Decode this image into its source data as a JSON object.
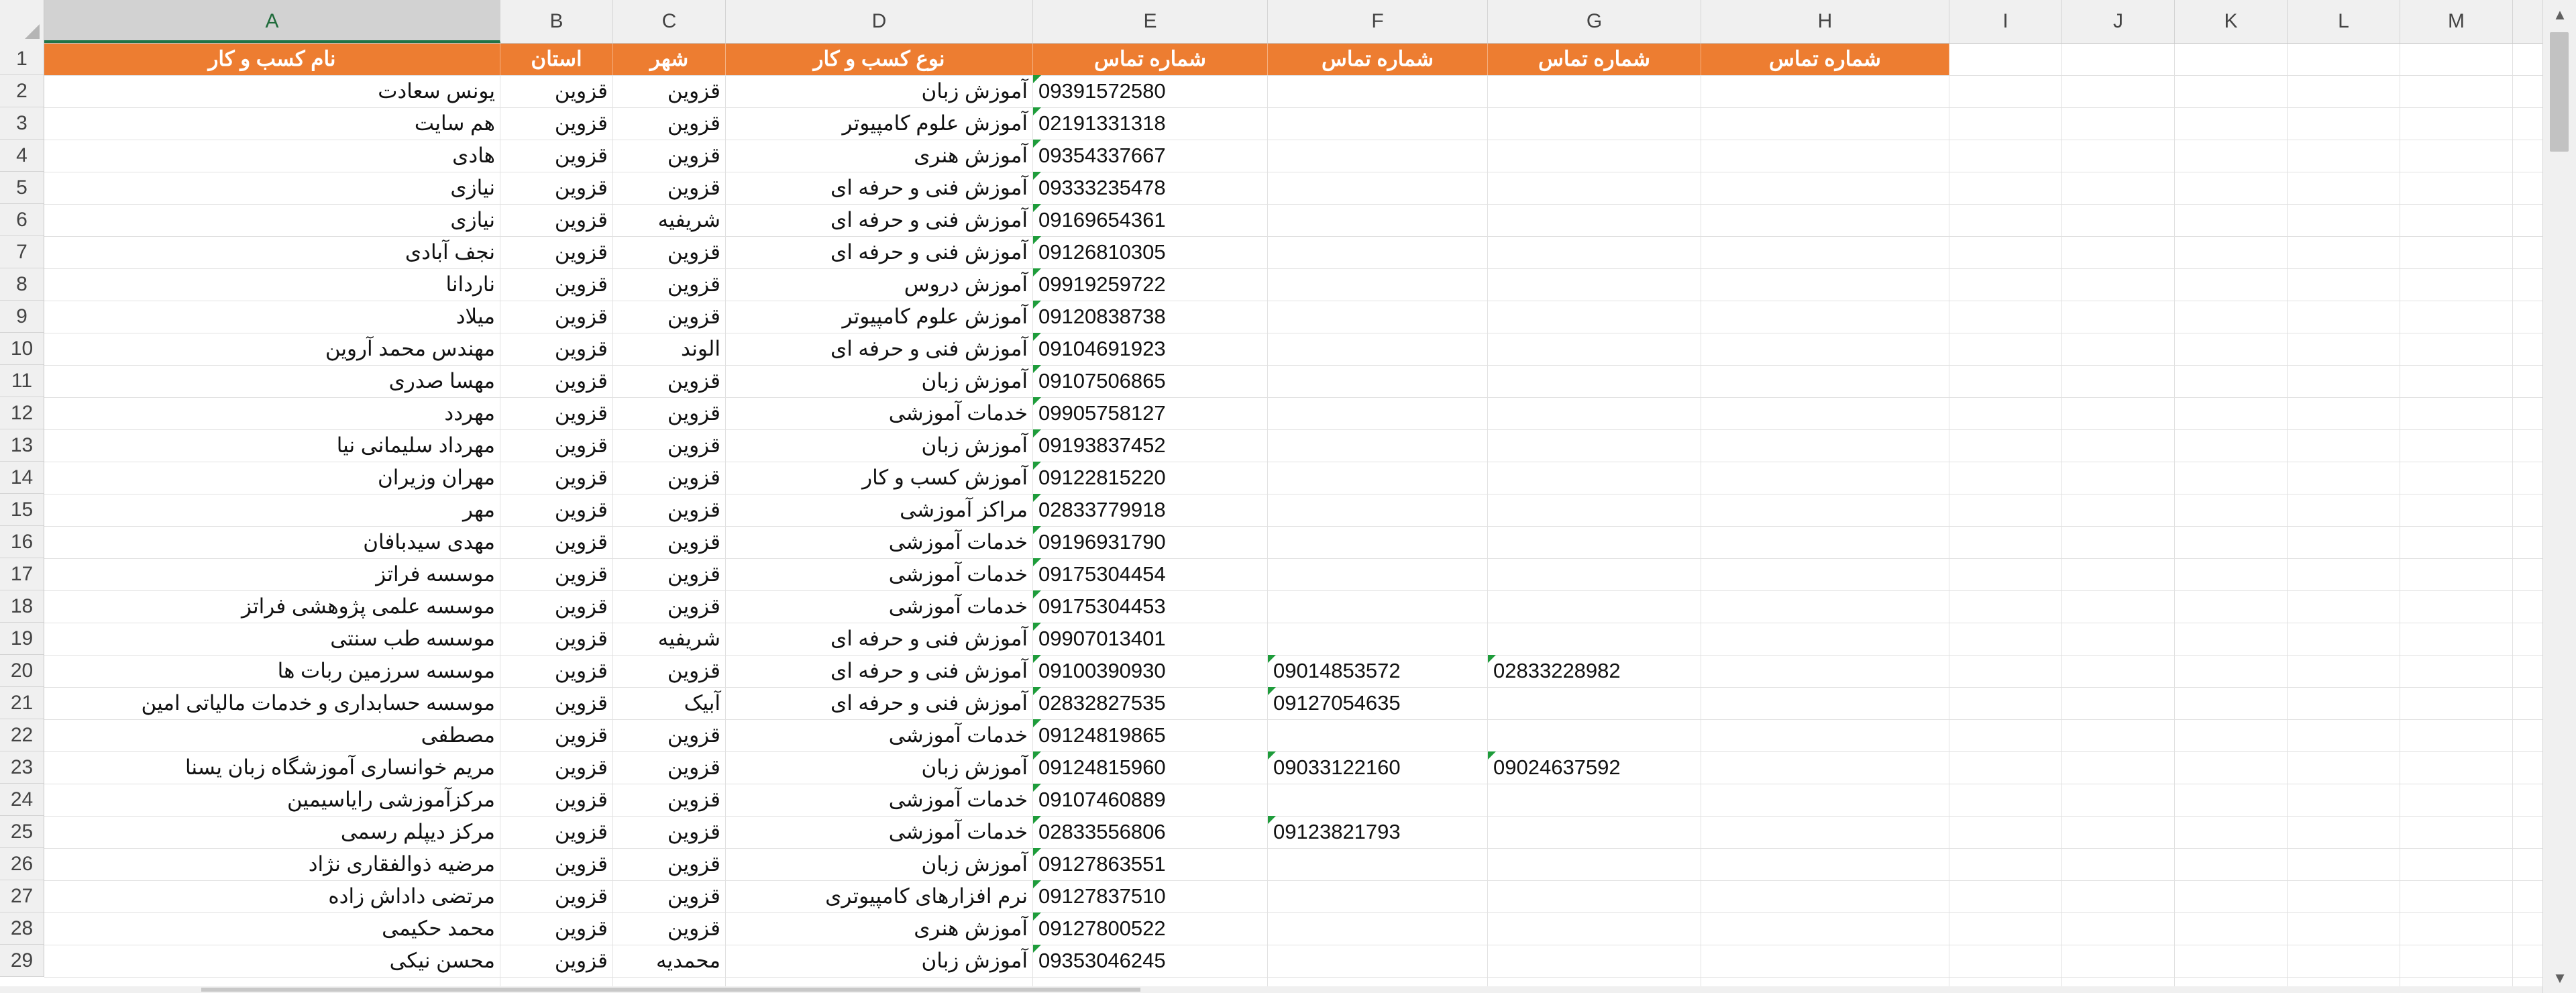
{
  "columns": [
    {
      "letter": "A",
      "active": true
    },
    {
      "letter": "B"
    },
    {
      "letter": "C"
    },
    {
      "letter": "D"
    },
    {
      "letter": "E"
    },
    {
      "letter": "F"
    },
    {
      "letter": "G"
    },
    {
      "letter": "H"
    },
    {
      "letter": "I"
    },
    {
      "letter": "J"
    },
    {
      "letter": "K"
    },
    {
      "letter": "L"
    },
    {
      "letter": "M"
    }
  ],
  "header_row": {
    "A": "نام کسب و کار",
    "B": "استان",
    "C": "شهر",
    "D": "نوع کسب و کار",
    "E": "شماره تماس",
    "F": "شماره تماس",
    "G": "شماره تماس",
    "H": "شماره تماس"
  },
  "header_fill_color": "#ed7d31",
  "header_text_color": "#ffffff",
  "error_flag_color": "#1e9c3b",
  "rows": [
    {
      "n": "1"
    },
    {
      "n": "2",
      "A": "یونس سعادت",
      "B": "قزوین",
      "C": "قزوین",
      "D": "آموزش زبان",
      "E": "09391572580"
    },
    {
      "n": "3",
      "A": "هم سایت",
      "B": "قزوین",
      "C": "قزوین",
      "D": "آموزش علوم کامپیوتر",
      "E": "02191331318"
    },
    {
      "n": "4",
      "A": "هادی",
      "B": "قزوین",
      "C": "قزوین",
      "D": "آموزش هنری",
      "E": "09354337667"
    },
    {
      "n": "5",
      "A": "نیازی",
      "B": "قزوین",
      "C": "قزوین",
      "D": "آموزش فنی و حرفه ای",
      "E": "09333235478"
    },
    {
      "n": "6",
      "A": "نیازی",
      "B": "قزوین",
      "C": "شریفیه",
      "D": "آموزش فنی و حرفه ای",
      "E": "09169654361"
    },
    {
      "n": "7",
      "A": "نجف آبادی",
      "B": "قزوین",
      "C": "قزوین",
      "D": "آموزش فنی و حرفه ای",
      "E": "09126810305"
    },
    {
      "n": "8",
      "A": "ناردانا",
      "B": "قزوین",
      "C": "قزوین",
      "D": "آموزش دروس",
      "E": "09919259722"
    },
    {
      "n": "9",
      "A": "میلاد",
      "B": "قزوین",
      "C": "قزوین",
      "D": "آموزش علوم کامپیوتر",
      "E": "09120838738"
    },
    {
      "n": "10",
      "A": "مهندس محمد آروین",
      "B": "قزوین",
      "C": "الوند",
      "D": "آموزش فنی و حرفه ای",
      "E": "09104691923"
    },
    {
      "n": "11",
      "A": "مهسا صدری",
      "B": "قزوین",
      "C": "قزوین",
      "D": "آموزش زبان",
      "E": "09107506865"
    },
    {
      "n": "12",
      "A": "مهردد",
      "B": "قزوین",
      "C": "قزوین",
      "D": "خدمات آموزشی",
      "E": "09905758127"
    },
    {
      "n": "13",
      "A": "مهرداد سلیمانی نیا",
      "B": "قزوین",
      "C": "قزوین",
      "D": "آموزش زبان",
      "E": "09193837452"
    },
    {
      "n": "14",
      "A": "مهران وزیران",
      "B": "قزوین",
      "C": "قزوین",
      "D": "آموزش کسب و کار",
      "E": "09122815220"
    },
    {
      "n": "15",
      "A": "مهر",
      "B": "قزوین",
      "C": "قزوین",
      "D": "مراکز آموزشی",
      "E": "02833779918"
    },
    {
      "n": "16",
      "A": "مهدی سیدبافان",
      "B": "قزوین",
      "C": "قزوین",
      "D": "خدمات آموزشی",
      "E": "09196931790"
    },
    {
      "n": "17",
      "A": "موسسه فراتز",
      "B": "قزوین",
      "C": "قزوین",
      "D": "خدمات آموزشی",
      "E": "09175304454"
    },
    {
      "n": "18",
      "A": "موسسه علمی پژوهشی فراتز",
      "B": "قزوین",
      "C": "قزوین",
      "D": "خدمات آموزشی",
      "E": "09175304453"
    },
    {
      "n": "19",
      "A": "موسسه طب سنتی",
      "B": "قزوین",
      "C": "شریفیه",
      "D": "آموزش فنی و حرفه ای",
      "E": "09907013401"
    },
    {
      "n": "20",
      "A": "موسسه سرزمین ربات ها",
      "B": "قزوین",
      "C": "قزوین",
      "D": "آموزش فنی و حرفه ای",
      "E": "09100390930",
      "F": "09014853572",
      "G": "02833228982"
    },
    {
      "n": "21",
      "A": "موسسه حسابداری و خدمات مالیاتی امین",
      "B": "قزوین",
      "C": "آبیک",
      "D": "آموزش فنی و حرفه ای",
      "E": "02832827535",
      "F": "09127054635"
    },
    {
      "n": "22",
      "A": "مصطفی",
      "B": "قزوین",
      "C": "قزوین",
      "D": "خدمات آموزشی",
      "E": "09124819865"
    },
    {
      "n": "23",
      "A": "مریم خوانساری  آموزشگاه زبان یسنا",
      "B": "قزوین",
      "C": "قزوین",
      "D": "آموزش زبان",
      "E": "09124815960",
      "F": "09033122160",
      "G": "09024637592"
    },
    {
      "n": "24",
      "A": "مرکزآموزشی رایاسیمین",
      "B": "قزوین",
      "C": "قزوین",
      "D": "خدمات آموزشی",
      "E": "09107460889"
    },
    {
      "n": "25",
      "A": "مرکز دیپلم رسمی",
      "B": "قزوین",
      "C": "قزوین",
      "D": "خدمات آموزشی",
      "E": "02833556806",
      "F": "09123821793"
    },
    {
      "n": "26",
      "A": "مرضیه ذوالفقاری نژاد",
      "B": "قزوین",
      "C": "قزوین",
      "D": "آموزش زبان",
      "E": "09127863551"
    },
    {
      "n": "27",
      "A": "مرتضی داداش زاده",
      "B": "قزوین",
      "C": "قزوین",
      "D": "نرم افزارهای کامپیوتری",
      "E": "09127837510"
    },
    {
      "n": "28",
      "A": "محمد حکیمی",
      "B": "قزوین",
      "C": "قزوین",
      "D": "آموزش هنری",
      "E": "09127800522"
    },
    {
      "n": "29",
      "A": "محسن نیکی",
      "B": "قزوین",
      "C": "محمدیه",
      "D": "آموزش زبان",
      "E": "09353046245"
    }
  ],
  "scroll_up_icon": "▲",
  "scroll_down_icon": "▼"
}
